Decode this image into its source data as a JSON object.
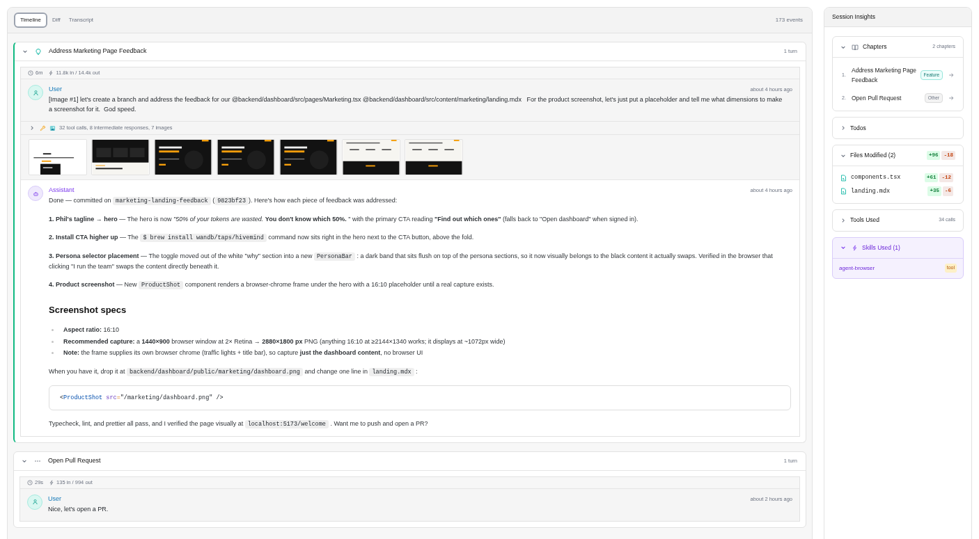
{
  "tabs": [
    {
      "label": "Timeline",
      "selected": true
    },
    {
      "label": "Diff",
      "selected": false
    },
    {
      "label": "Transcript",
      "selected": false
    }
  ],
  "event_count": "173 events",
  "chapters": [
    {
      "title": "Address Marketing Page Feedback",
      "turns": "1 turn",
      "kind": "feature",
      "expanded": true,
      "active": true,
      "duration": "6m",
      "tokens": "11.8k in / 14.4k out",
      "messages": [
        {
          "kind": "user",
          "author": "User",
          "time": "about 4 hours ago",
          "text": "[Image #1] let's create a branch and address the feedback for our @backend/dashboard/src/pages/Marketing.tsx @backend/dashboard/src/content/marketing/landing.mdx   For the product screenshot, let's just put a placeholder and tell me what dimensions to make a screenshot for it.  God speed."
        },
        {
          "kind": "tools",
          "expanded": false,
          "summary": "32 tool calls, 8 intermediate responses, 7 images"
        },
        {
          "kind": "assistant",
          "author": "Assistant",
          "time": "about 4 hours ago",
          "blocks": [
            {
              "kind": "p",
              "parts": [
                {
                  "text": "Done — committed on "
                },
                {
                  "code": "marketing-landing-feedback"
                },
                {
                  "text": " ("
                },
                {
                  "code": "9823bf23"
                },
                {
                  "text": "). Here's how each piece of feedback was addressed:"
                }
              ]
            },
            {
              "kind": "p",
              "parts": [
                {
                  "text": "**1. Phil's tagline → hero** — The hero is now *\"50% of your tokens are wasted.* **You don't know which 50%.** \" with the primary CTA reading **\"Find out which ones\"** (falls back to \"Open dashboard\" when signed in)."
                }
              ]
            },
            {
              "kind": "p",
              "parts": [
                {
                  "text": "**2. Install CTA higher up** — The "
                },
                {
                  "code": "$ brew install wandb/taps/hivemind"
                },
                {
                  "text": " command now sits right in the hero next to the CTA button, above the fold."
                }
              ]
            },
            {
              "kind": "p",
              "parts": [
                {
                  "text": "**3. Persona selector placement** — The toggle moved out of the white \"why\" section into a new "
                },
                {
                  "code": "PersonaBar"
                },
                {
                  "text": " : a dark band that sits flush on top of the persona sections, so it now visually belongs to the black content it actually swaps. Verified in the browser that clicking \"I run the team\" swaps the content directly beneath it."
                }
              ]
            },
            {
              "kind": "p",
              "parts": [
                {
                  "text": "**4. Product screenshot** — New "
                },
                {
                  "code": "ProductShot"
                },
                {
                  "text": " component renders a browser-chrome frame under the hero with a 16:10 placeholder until a real capture exists."
                }
              ]
            },
            {
              "kind": "h",
              "text": "Screenshot specs"
            },
            {
              "kind": "ul",
              "items": [
                [
                  {
                    "text": "**Aspect ratio:** 16:10"
                  }
                ],
                [
                  {
                    "text": "**Recommended capture:** a **1440×900** browser window at 2× Retina → **2880×1800 px** PNG (anything 16:10 at ≥2144×1340 works; it displays at ~1072px wide)"
                  }
                ],
                [
                  {
                    "text": "**Note:** the frame supplies its own browser chrome (traffic lights + title bar), so capture **just the dashboard content**, no browser UI"
                  }
                ]
              ]
            },
            {
              "kind": "p",
              "parts": [
                {
                  "text": "When you have it, drop it at "
                },
                {
                  "code": "backend/dashboard/public/marketing/dashboard.png"
                },
                {
                  "text": " and change one line in "
                },
                {
                  "code": "landing.mdx"
                },
                {
                  "text": " :"
                }
              ]
            },
            {
              "kind": "code",
              "tokens": [
                {
                  "kind": "punct",
                  "text": "<"
                },
                {
                  "kind": "tag",
                  "text": "ProductShot"
                },
                {
                  "kind": "attr",
                  "text": " src"
                },
                {
                  "kind": "op",
                  "text": "="
                },
                {
                  "kind": "string",
                  "text": "\"/marketing/dashboard.png\""
                },
                {
                  "kind": "punct",
                  "text": " />"
                }
              ]
            },
            {
              "kind": "p",
              "parts": [
                {
                  "text": "Typecheck, lint, and prettier all pass, and I verified the page visually at "
                },
                {
                  "code": "localhost:5173/welcome"
                },
                {
                  "text": " . Want me to push and open a PR?"
                }
              ]
            }
          ]
        }
      ]
    },
    {
      "title": "Open Pull Request",
      "turns": "1 turn",
      "kind": "other",
      "expanded": true,
      "active": false,
      "duration": "29s",
      "tokens": "135 in / 994 out",
      "messages": [
        {
          "kind": "user",
          "author": "User",
          "time": "about 2 hours ago",
          "text": "Nice, let's open a PR."
        }
      ]
    }
  ],
  "insights": {
    "title": "Session Insights",
    "sections": [
      {
        "kind": "chapters",
        "title": "Chapters",
        "expanded": true,
        "count": "2 chapters",
        "items": [
          {
            "number": "1.",
            "title": "Address Marketing Page Feedback",
            "tag": "Feature",
            "kind": "feature"
          },
          {
            "number": "2.",
            "title": "Open Pull Request",
            "tag": "Other",
            "kind": "other"
          }
        ]
      },
      {
        "kind": "plain",
        "title": "Todos",
        "expanded": false
      },
      {
        "kind": "files",
        "title": "Files Modified (2)",
        "expanded": true,
        "added": "+96",
        "removed": "-18",
        "files": [
          {
            "name": "components.tsx",
            "added": "+61",
            "removed": "-12"
          },
          {
            "name": "landing.mdx",
            "added": "+35",
            "removed": "-6"
          }
        ]
      },
      {
        "kind": "plain",
        "title": "Tools Used",
        "expanded": false,
        "count": "34 calls"
      },
      {
        "kind": "skills",
        "title": "Skills Used (1)",
        "expanded": true,
        "skills": [
          {
            "name": "agent-browser",
            "tag": "tool"
          }
        ]
      }
    ]
  }
}
